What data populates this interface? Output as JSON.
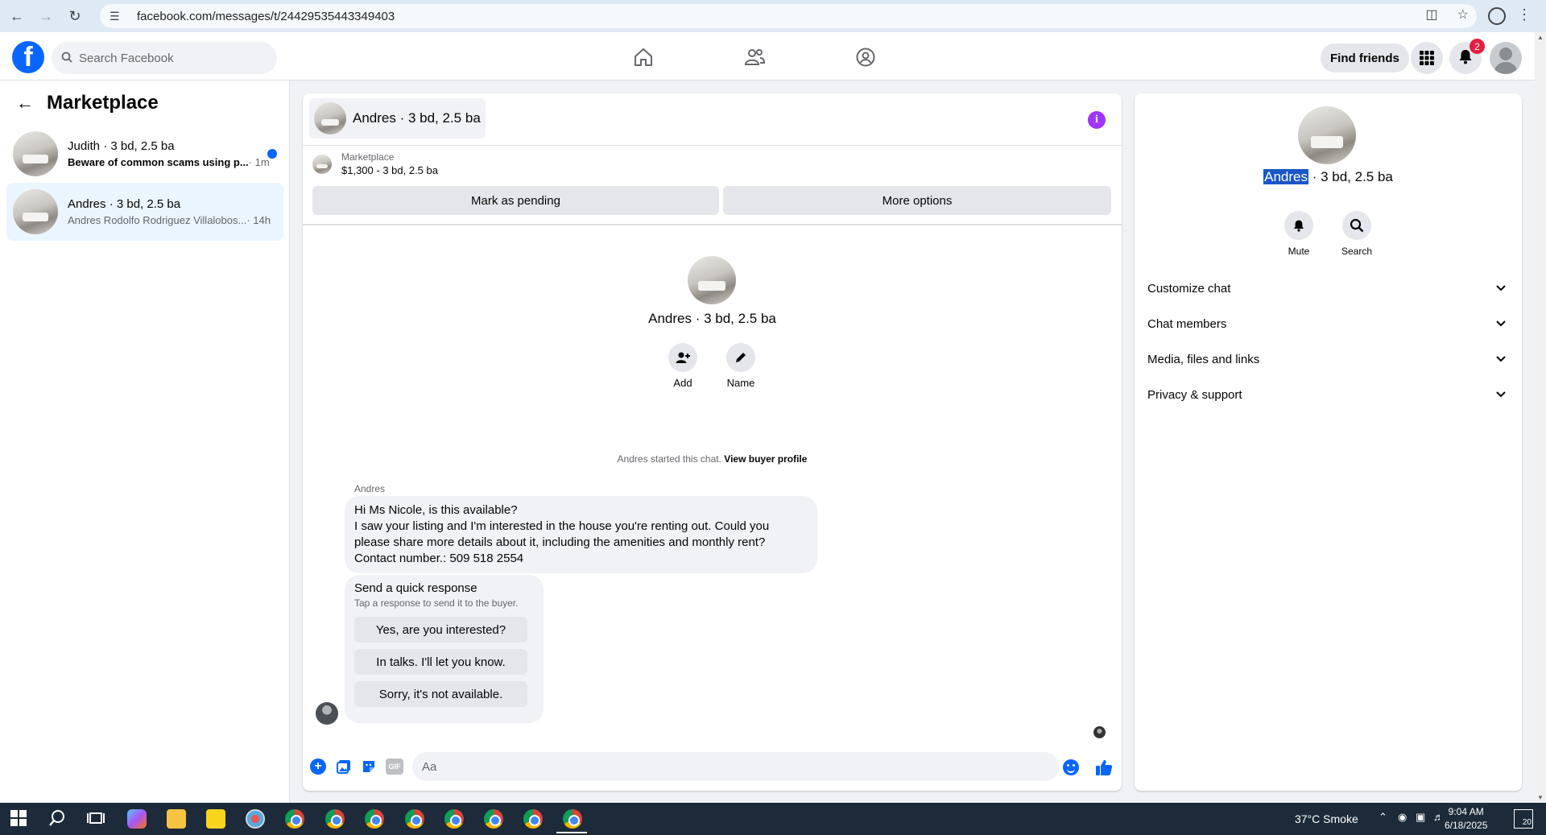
{
  "browser": {
    "url": "facebook.com/messages/t/24429535443349403"
  },
  "header": {
    "logo_letter": "f",
    "search_placeholder": "Search Facebook",
    "find_friends_label": "Find friends",
    "notifications_count": "2"
  },
  "sidebar": {
    "title": "Marketplace",
    "conversations": [
      {
        "title": "Judith · 3 bd, 2.5 ba",
        "preview": "Beware of common scams using p...",
        "time": "· 1m",
        "unread": true
      },
      {
        "title": "Andres · 3 bd, 2.5 ba",
        "preview": "Andres Rodolfo Rodriguez Villalobos...",
        "time": "· 14h",
        "unread": false
      }
    ]
  },
  "chat": {
    "header_title": "Andres · 3 bd, 2.5 ba",
    "listing_label": "Marketplace",
    "listing_value": "$1,300 - 3 bd, 2.5 ba",
    "mark_pending_label": "Mark as pending",
    "more_options_label": "More options",
    "intro_title": "Andres · 3 bd, 2.5 ba",
    "intro_actions": {
      "add": "Add",
      "name": "Name"
    },
    "started_text": "Andres started this chat.",
    "view_buyer_profile": "View buyer profile",
    "sender_name": "Andres",
    "message_lines": [
      "Hi Ms Nicole,  is this available?",
      "I saw your listing and I'm interested in the house you're renting out. Could you",
      "please share more details about it, including the amenities and monthly rent?",
      "Contact number.: 509 518 2554"
    ],
    "quick_response": {
      "title": "Send a quick response",
      "subtitle": "Tap a response to send it to the buyer.",
      "options": [
        "Yes, are you interested?",
        "In talks. I'll let you know.",
        "Sorry, it's not available."
      ]
    },
    "composer_placeholder": "Aa",
    "composer_icons": [
      "plus-icon",
      "photo-icon",
      "sticker-icon",
      "gif-icon"
    ],
    "gif_label": "GIF"
  },
  "details": {
    "title_highlight": "Andres",
    "title_rest": " · 3 bd, 2.5 ba",
    "mute_label": "Mute",
    "search_label": "Search",
    "sections": [
      "Customize chat",
      "Chat members",
      "Media, files and links",
      "Privacy & support"
    ]
  },
  "taskbar": {
    "weather": "37°C  Smoke",
    "time": "9:04 AM",
    "date": "6/18/2025",
    "notification_count": "20"
  },
  "colors": {
    "brand": "#0866ff",
    "info": "#a033ff",
    "badge": "#e41e3f",
    "active_row": "#ebf5ff"
  }
}
